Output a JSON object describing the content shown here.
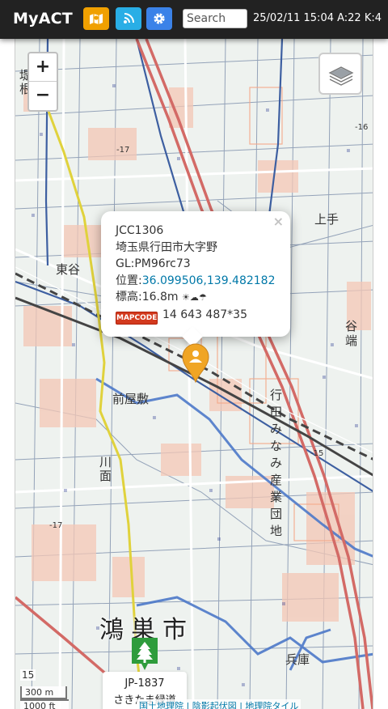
{
  "navbar": {
    "brand": "MyACT",
    "search_placeholder": "Search",
    "status_text": "25/02/11 15:04 A:22 K:4",
    "buttons": [
      {
        "icon": "map-icon",
        "color": "#f0a000"
      },
      {
        "icon": "signal-icon",
        "color": "#29aee6"
      },
      {
        "icon": "gear-icon",
        "color": "#3b82e8"
      }
    ]
  },
  "map": {
    "zoom_in": "+",
    "zoom_out": "−",
    "layers_icon": "layers-icon",
    "zoom_level": "15",
    "scale_metric": "300 m",
    "scale_imperial": "1000 ft",
    "city_label": "鴻巣市",
    "attribution": "国土地理院 | 陰影起伏図 | 地理院タイル",
    "popup": {
      "close": "×",
      "code": "JCC1306",
      "address": "埼玉県行田市大字野",
      "grid": "GL:PM96rc73",
      "position_label": "位置:",
      "position_value": "36.099506,139.482182",
      "elevation": "標高:16.8m",
      "weather": "☀☁☂",
      "mapcode_logo": "MAPCODE",
      "mapcode_value": "14 643 487*35"
    },
    "green_marker": {
      "icon": "tree-icon",
      "code": "JP-1837",
      "name": "さきたま緑道"
    }
  },
  "colors": {
    "navbar_bg": "#222222",
    "accent_orange": "#f0a000",
    "accent_cyan": "#29aee6",
    "accent_blue": "#3b82e8",
    "link": "#0078a8",
    "marker_green": "#2e9c3c"
  }
}
